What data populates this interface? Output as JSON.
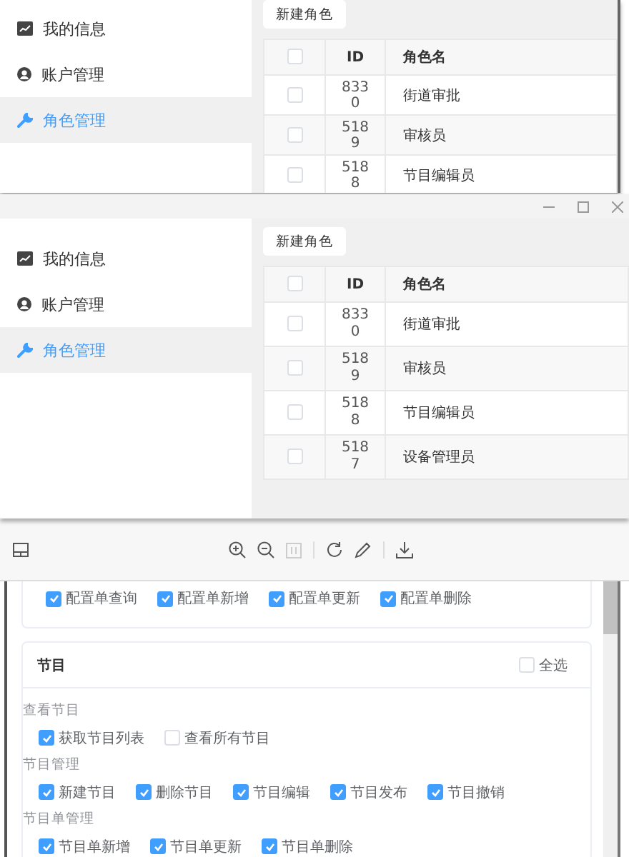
{
  "screens": [
    {
      "title_bar": false,
      "sidebar": [
        {
          "label": "我的信息",
          "selected": false
        },
        {
          "label": "账户管理",
          "selected": false
        },
        {
          "label": "角色管理",
          "selected": true
        }
      ],
      "new_button": "新建角色",
      "table": {
        "select_all_checked": false,
        "columns": [
          "ID",
          "角色名"
        ],
        "rows": [
          {
            "id": "8330",
            "name": "街道审批",
            "checked": false
          },
          {
            "id": "5189",
            "name": "审核员",
            "checked": false
          },
          {
            "id": "5188",
            "name": "节目编辑员",
            "checked": false
          }
        ]
      }
    },
    {
      "title_bar": true,
      "sidebar": [
        {
          "label": "我的信息",
          "selected": false
        },
        {
          "label": "账户管理",
          "selected": false
        },
        {
          "label": "角色管理",
          "selected": true
        }
      ],
      "new_button": "新建角色",
      "table": {
        "select_all_checked": false,
        "columns": [
          "ID",
          "角色名"
        ],
        "rows": [
          {
            "id": "8330",
            "name": "街道审批",
            "checked": false
          },
          {
            "id": "5189",
            "name": "审核员",
            "checked": false
          },
          {
            "id": "5188",
            "name": "节目编辑员",
            "checked": false
          },
          {
            "id": "5187",
            "name": "设备管理员",
            "checked": false
          }
        ]
      }
    }
  ],
  "viewer": {
    "top_items": [
      {
        "label": "配置单查询",
        "checked": true
      },
      {
        "label": "配置单新增",
        "checked": true
      },
      {
        "label": "配置单更新",
        "checked": true
      },
      {
        "label": "配置单删除",
        "checked": true
      }
    ],
    "section": {
      "title": "节目",
      "select_all": {
        "label": "全选",
        "checked": false
      },
      "groups": [
        {
          "title": "查看节目",
          "items": [
            {
              "label": "获取节目列表",
              "checked": true
            },
            {
              "label": "查看所有节目",
              "checked": false
            }
          ]
        },
        {
          "title": "节目管理",
          "items": [
            {
              "label": "新建节目",
              "checked": true
            },
            {
              "label": "删除节目",
              "checked": true
            },
            {
              "label": "节目编辑",
              "checked": true
            },
            {
              "label": "节目发布",
              "checked": true
            },
            {
              "label": "节目撤销",
              "checked": true
            }
          ]
        },
        {
          "title": "节目单管理",
          "items": [
            {
              "label": "节目单新增",
              "checked": true
            },
            {
              "label": "节目单更新",
              "checked": true
            },
            {
              "label": "节目单删除",
              "checked": true
            }
          ]
        }
      ]
    }
  }
}
